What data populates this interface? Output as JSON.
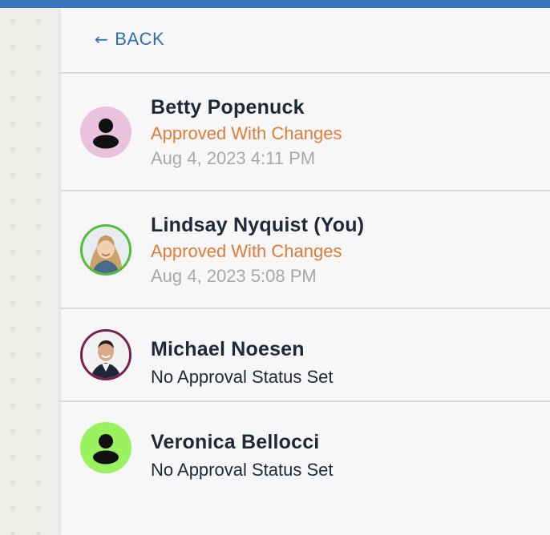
{
  "header": {
    "back_label": "BACK",
    "back_arrow": "←"
  },
  "reviewers": [
    {
      "name": "Betty Popenuck",
      "status": "Approved With Changes",
      "timestamp": "Aug 4, 2023 4:11 PM",
      "avatar": {
        "type": "placeholder-person-icon",
        "bg": "#e9c2dd"
      }
    },
    {
      "name": "Lindsay Nyquist (You)",
      "status": "Approved With Changes",
      "timestamp": "Aug 4, 2023 5:08 PM",
      "avatar": {
        "type": "photo",
        "ring": "#4fbf3a"
      }
    },
    {
      "name": "Michael Noesen",
      "status": "No Approval Status Set",
      "avatar": {
        "type": "photo",
        "ring": "#7a1f4d"
      }
    },
    {
      "name": "Veronica Bellocci",
      "status": "No Approval Status Set",
      "avatar": {
        "type": "placeholder-person-icon",
        "bg": "#9af25f"
      }
    }
  ],
  "colors": {
    "accent_blue": "#2f6fb0",
    "top_bar": "#3a78bd",
    "approved_orange": "#e07b39",
    "timestamp_gray": "#a8a8a8"
  }
}
